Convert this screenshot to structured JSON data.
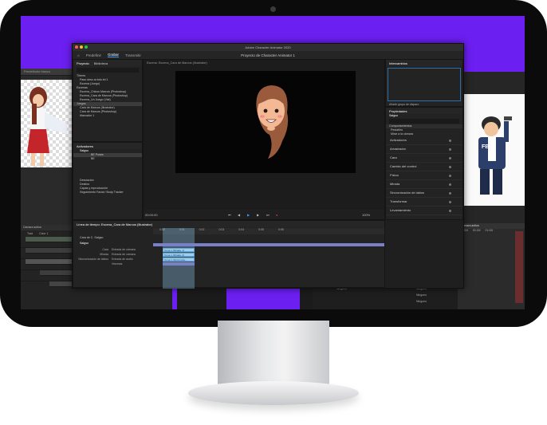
{
  "window": {
    "title": "Adobe Character Animator 2020",
    "app_tabs": [
      "Predefinir",
      "Grabar",
      "Transmitir"
    ],
    "active_tab": "Grabar",
    "project_title": "Proyecto de Character Animator 1"
  },
  "project_panel": {
    "tabs": [
      "Proyecto",
      "Biblioteca"
    ],
    "items": [
      "Títeres",
      "Paso desc.ar.bdo.txt 1",
      "Escena (Juego)",
      "Escenas",
      "Escena_Chicos Marcos (Photoshop)",
      "Escena_Cara de Marcos (Photoshop)",
      "Escena_Un Juego (Vist)",
      "Juegos",
      "Cara de Marcos (Illustrator)",
      "Cara de Marcos (Photoshop)",
      "Marcador 1"
    ],
    "selected_index": 7
  },
  "triggers_panel": {
    "title": "Activadores",
    "puppet": "Salgso",
    "rows": [
      "BE Poses",
      "BE"
    ],
    "sub_title": "Desviación",
    "checks": [
      "Destino",
      "Mas pagos"
    ],
    "footer": [
      "Capas y reproducción",
      "Seguimiento Facial / Body Tracker"
    ]
  },
  "scene_panel": {
    "tab": "Escena: Escena_Cara de Marcos (Illustrator)",
    "timecode": "00:00:00",
    "zoom": "100%"
  },
  "triggers_right": {
    "title": "Intercambios",
    "footer": "Añadir grupo de disparo"
  },
  "properties_panel": {
    "title": "Propiedades",
    "puppet": "Salgso",
    "subtitle": "Comportamientos",
    "sections": [
      "Pestañeo",
      "Mirar a la cámara",
      "Activadores",
      "Arrastrador",
      "Cara",
      "Cambio del control",
      "Física",
      "Mirada",
      "Sincronización de labios",
      "Transformar",
      "Levantamiento"
    ]
  },
  "timeline_panel": {
    "tab": "Línea de tiempo: Escena_Cara de Marcos (Illustrator)",
    "ruler": [
      "0:00",
      "0:01",
      "0:02",
      "0:03",
      "0:04",
      "0:05",
      "0:06"
    ],
    "layer": "Cara de C. Salgso",
    "puppet": "Salgso",
    "rows": [
      {
        "name": "Cara",
        "input": "Entrada de cámara"
      },
      {
        "name": "Mirada",
        "input": "Entrada de cámara"
      },
      {
        "name": "Sincronización de labios",
        "input": "Entrada de audio"
      },
      {
        "name": "",
        "input": "Visemas"
      }
    ],
    "clips": [
      "Toma 1 (Mirada, 1)",
      "Toma 1 (Mirada, 2)",
      "Toma 1 (Sincroniza..."
    ]
  },
  "left_window": {
    "title": "Predefinido blanco",
    "footer_tab": "Cámara activa",
    "fields": [
      "Predefinido blanco",
      "Trad",
      "Color 1"
    ]
  },
  "right_window": {
    "header": "FBI",
    "footer_tab": "Cámara activa",
    "ruler": [
      "00:00f",
      "00:15f",
      "01:00f",
      "01:15f"
    ],
    "rows_label": "Ninguno"
  },
  "colors": {
    "screen_bg": "#6b1ff0",
    "accent": "#3aa0ff",
    "clip": "#9fcfef"
  }
}
